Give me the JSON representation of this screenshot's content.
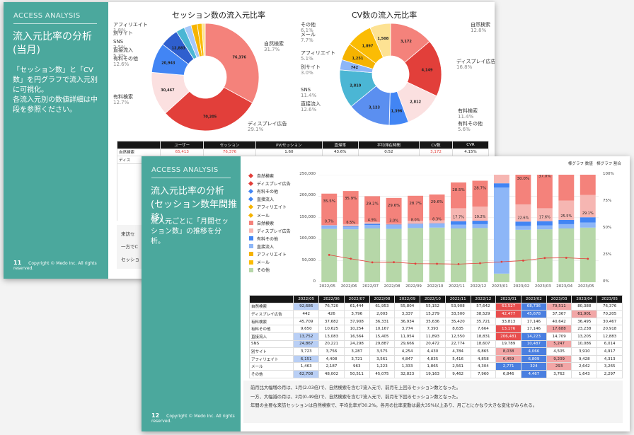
{
  "slide1": {
    "brand": "ACCESS ANALYSIS",
    "title": "流入元比率の分析\n(当月)",
    "desc": "「セッション数」と「CV数」を円グラフで流入元別に可視化。\n各流入元別の数値詳細は中段を参照ください。",
    "page": "11",
    "copyright": "Copyright © Medo Inc. All rights reserved.",
    "bottom_text": [
      "来訪セ",
      "一方でC",
      "セッショ"
    ],
    "table": {
      "headers": [
        "",
        "ユーザー",
        "セッション",
        "PV/セッション",
        "直帰率",
        "平均滞在時間",
        "CV数",
        "CVR"
      ],
      "row": [
        "自然検索",
        "65,413",
        "76,376",
        "1.60",
        "43.6%",
        "0:52",
        "3,172",
        "4.15%"
      ],
      "row2_label": "ディス"
    }
  },
  "chart_data": [
    {
      "type": "pie",
      "title": "セッション数の流入元比率",
      "labels": [
        "自然検索",
        "ディスプレイ広告",
        "有料検索",
        "有料その他",
        "直接流入",
        "SNS",
        "別サイト",
        "アフィリエイト",
        "メール",
        "その他"
      ],
      "values": [
        76376,
        70205,
        30467,
        20943,
        12883,
        6014,
        4917,
        4313,
        3265,
        2297
      ],
      "colors": [
        "#f4827b",
        "#e23f3a",
        "#fbe0e0",
        "#4285f4",
        "#2f5fce",
        "#4bb6d4",
        "#a5c8f9",
        "#f5b300",
        "#fbbc04",
        "#fde293"
      ],
      "callouts": [
        {
          "text": "自然検索",
          "pct": "31.7%"
        },
        {
          "text": "ディスプレイ広告",
          "pct": "29.1%"
        },
        {
          "text": "有料検索",
          "pct": "12.7%"
        },
        {
          "text": "有料その他",
          "pct": "12.6%"
        },
        {
          "text": "直接流入",
          "pct": "5.3%"
        },
        {
          "text": "SNS",
          "pct": "2.5%"
        },
        {
          "text": "別サイト",
          "pct": ""
        },
        {
          "text": "アフィリエイト",
          "pct": "1.8%"
        }
      ],
      "slice_labels": [
        "76,376",
        "70,205",
        "30,467",
        "20,943",
        "12,883"
      ]
    },
    {
      "type": "pie",
      "title": "CV数の流入元比率",
      "labels": [
        "自然検索",
        "ディスプレイ広告",
        "有料検索",
        "有料その他",
        "直接流入",
        "SNS",
        "別サイト",
        "アフィリエイト",
        "メール",
        "その他"
      ],
      "values": [
        3172,
        4149,
        2812,
        1396,
        3123,
        2810,
        742,
        1251,
        1897,
        1508
      ],
      "colors": [
        "#f4827b",
        "#e23f3a",
        "#fbe0e0",
        "#4285f4",
        "#5b8ff0",
        "#4bb6d4",
        "#8db6f7",
        "#f5b300",
        "#fbbc04",
        "#fde293"
      ],
      "callouts": [
        {
          "text": "自然検索",
          "pct": "12.8%"
        },
        {
          "text": "ディスプレイ広告",
          "pct": "16.8%"
        },
        {
          "text": "有料検索",
          "pct": "11.4%"
        },
        {
          "text": "有料その他",
          "pct": "5.6%"
        },
        {
          "text": "直接流入",
          "pct": "12.6%"
        },
        {
          "text": "SNS",
          "pct": "11.4%"
        },
        {
          "text": "別サイト",
          "pct": "3.0%"
        },
        {
          "text": "アフィリエイト",
          "pct": "5.1%"
        },
        {
          "text": "メール",
          "pct": "7.7%"
        },
        {
          "text": "その他",
          "pct": "6.1%"
        }
      ],
      "slice_labels": [
        "3,172",
        "4,149",
        "2,812",
        "1,396",
        "3,123",
        "2,810",
        "742",
        "1,251",
        "1,897",
        "1,508"
      ]
    },
    {
      "type": "bar",
      "stacked": true,
      "categories": [
        "2022/05",
        "2022/06",
        "2022/07",
        "2022/08",
        "2022/09",
        "2022/10",
        "2022/11",
        "2022/12",
        "2023/01",
        "2023/02",
        "2023/03",
        "2023/04",
        "2023/05"
      ],
      "header_right": "棒グラフ 数値　棒グラフ 割合",
      "ylim": [
        0,
        250000
      ],
      "y2lim": [
        0,
        100
      ],
      "yticks": [
        "250,000",
        "200,000",
        "150,000",
        "100,000",
        "50,000",
        "0"
      ],
      "y2ticks": [
        "100%",
        "75%",
        "50%",
        "25%",
        "0%"
      ],
      "legend": [
        {
          "name": "自然検索",
          "color": "#e23f3a",
          "kind": "line"
        },
        {
          "name": "ディスプレイ広告",
          "color": "#e23f3a",
          "kind": "line"
        },
        {
          "name": "有料その他",
          "color": "#4285f4",
          "kind": "line"
        },
        {
          "name": "直接流入",
          "color": "#4285f4",
          "kind": "line"
        },
        {
          "name": "アフィリエイト",
          "color": "#f5b300",
          "kind": "line"
        },
        {
          "name": "メール",
          "color": "#f5b300",
          "kind": "line"
        },
        {
          "name": "自然検索",
          "color": "#f4827b",
          "kind": "bar"
        },
        {
          "name": "ディスプレイ広告",
          "color": "#f6b6b2",
          "kind": "bar"
        },
        {
          "name": "有料その他",
          "color": "#4285f4",
          "kind": "bar"
        },
        {
          "name": "直接流入",
          "color": "#8db6f7",
          "kind": "bar"
        },
        {
          "name": "アフィリエイト",
          "color": "#f5b300",
          "kind": "bar"
        },
        {
          "name": "メール",
          "color": "#fbbc04",
          "kind": "bar"
        },
        {
          "name": "その他",
          "color": "#b6d7a8",
          "kind": "bar"
        }
      ],
      "pct_top": [
        "35.5%",
        "35.9%",
        "29.2%",
        "29.6%",
        "28.7%",
        "29.6%",
        "28.5%",
        "28.7%",
        "15.5%",
        "30.0%",
        "37.0%",
        "33.1%",
        "31.7%"
      ],
      "pct_mid": [
        "0.7%",
        "6.5%",
        "4.9%",
        "3.0%",
        "8.0%",
        "8.3%",
        "17.7%",
        "19.2%",
        "",
        "22.6%",
        "17.6%",
        "25.5%",
        "29.1%"
      ],
      "series": [
        {
          "name": "その他",
          "color": "#b6d7a8",
          "values": [
            124000,
            123000,
            125000,
            124000,
            126000,
            127000,
            125000,
            126000,
            20000,
            122000,
            123000,
            125000,
            127000
          ]
        },
        {
          "name": "直接流入",
          "color": "#8db6f7",
          "values": [
            7000,
            6000,
            8000,
            9000,
            9000,
            9000,
            9000,
            9000,
            200000,
            9000,
            9000,
            10000,
            12000
          ]
        },
        {
          "name": "有料その他",
          "color": "#4285f4",
          "values": [
            1000,
            1000,
            3000,
            1000,
            1000,
            1000,
            8000,
            8000,
            10000,
            10000,
            10000,
            10000,
            12000
          ]
        },
        {
          "name": "ディスプレイ広告",
          "color": "#f6b6b2",
          "values": [
            1000,
            5000,
            4000,
            2000,
            7000,
            7000,
            30000,
            33000,
            30000,
            40000,
            30000,
            45000,
            52000
          ]
        },
        {
          "name": "自然検索",
          "color": "#f4827b",
          "values": [
            73000,
            77000,
            60000,
            60000,
            58000,
            60000,
            60000,
            60000,
            42000,
            77000,
            92000,
            95000,
            76000
          ]
        }
      ],
      "line_values": [
        92686,
        76720,
        61444,
        61953,
        55804,
        55152,
        53908,
        57642,
        63527,
        68736,
        79511,
        80388,
        76376
      ]
    }
  ],
  "slide2": {
    "brand": "ACCESS ANALYSIS",
    "title": "流入元比率の分析\n(セッション数年間推移)",
    "desc": "流入元ごとに「月間セッション数」の推移を分析。",
    "page": "12",
    "copyright": "Copyright © Medo Inc. All rights reserved.",
    "table": {
      "headers": [
        "",
        "2022/05",
        "2022/06",
        "2022/07",
        "2022/08",
        "2022/09",
        "2022/10",
        "2022/11",
        "2022/12",
        "2023/01",
        "2023/02",
        "2023/03",
        "2023/04",
        "2023/05"
      ],
      "rows": [
        [
          "自然検索",
          "92,686",
          "76,720",
          "61,444",
          "61,953",
          "55,804",
          "55,152",
          "53,908",
          "57,642",
          "63,527",
          "68,736",
          "79,511",
          "80,388",
          "76,376"
        ],
        [
          "ディスプレイ広告",
          "442",
          "426",
          "3,796",
          "2,003",
          "3,337",
          "15,279",
          "33,500",
          "38,529",
          "42,477",
          "45,678",
          "37,367",
          "61,901",
          "70,205"
        ],
        [
          "有料検索",
          "45,709",
          "37,682",
          "37,908",
          "36,331",
          "36,934",
          "35,636",
          "35,420",
          "35,721",
          "33,813",
          "17,146",
          "40,642",
          "36,495",
          "30,467"
        ],
        [
          "有料その他",
          "9,650",
          "10,625",
          "10,254",
          "10,167",
          "3,774",
          "7,393",
          "8,635",
          "7,664",
          "13,176",
          "17,146",
          "17,688",
          "23,238",
          "20,918"
        ],
        [
          "直接流入",
          "13,752",
          "13,083",
          "16,564",
          "15,405",
          "11,954",
          "11,893",
          "12,550",
          "18,831",
          "206,481",
          "14,223",
          "14,709",
          "13,205",
          "12,883"
        ],
        [
          "SNS",
          "24,867",
          "20,221",
          "24,298",
          "29,887",
          "29,666",
          "20,472",
          "22,774",
          "18,607",
          "19,789",
          "10,487",
          "5,247",
          "10,086",
          "6,014"
        ],
        [
          "別サイト",
          "3,723",
          "3,756",
          "3,287",
          "3,575",
          "4,254",
          "4,430",
          "4,784",
          "6,865",
          "8,038",
          "4,066",
          "4,505",
          "3,910",
          "4,917"
        ],
        [
          "アフィリエイト",
          "6,151",
          "4,408",
          "3,721",
          "3,561",
          "4,847",
          "4,835",
          "5,416",
          "4,858",
          "6,459",
          "6,809",
          "9,209",
          "9,428",
          "4,313"
        ],
        [
          "メール",
          "1,463",
          "2,187",
          "963",
          "1,223",
          "1,333",
          "1,865",
          "2,561",
          "4,304",
          "2,771",
          "324",
          "293",
          "2,642",
          "3,265"
        ],
        [
          "その他",
          "62,708",
          "48,002",
          "50,511",
          "45,075",
          "32,823",
          "19,163",
          "9,462",
          "7,960",
          "6,846",
          "4,467",
          "3,762",
          "1,643",
          "2,297"
        ]
      ]
    },
    "notes": [
      "前月比大幅増の月は、1月(2.03倍)で、自然検索を含む7流入元で、前月を上回るセッション数となった。",
      "一方、大幅減の月は、2月(0.49倍)で、自然検索を含む7流入元で、前月を下回るセッション数となった。",
      "年間の主要な来訪セッションは自然検索で、平均比率が30.2%。各月の比率変動は最大35%以上あり、月ごとにかなり大きな変化がみられる。"
    ]
  }
}
